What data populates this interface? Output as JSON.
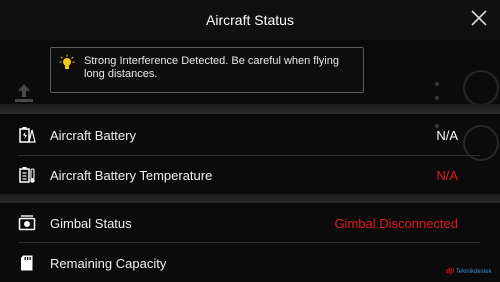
{
  "header": {
    "title": "Aircraft Status"
  },
  "alert": {
    "text": "Strong Interference Detected. Be careful when flying long distances."
  },
  "rows": [
    {
      "label": "Aircraft Battery",
      "value": "N/A",
      "value_color": "#ffffff",
      "icon": "battery-icon"
    },
    {
      "label": "Aircraft Battery Temperature",
      "value": "N/A",
      "value_color": "#e21b1b",
      "icon": "battery-temperature-icon"
    },
    {
      "label": "Gimbal Status",
      "value": "Gimbal Disconnected",
      "value_color": "#e21b1b",
      "icon": "gimbal-icon"
    },
    {
      "label": "Remaining Capacity",
      "value": "",
      "value_color": "#ffffff",
      "icon": "sd-card-icon"
    }
  ],
  "watermark": {
    "brand": "dji",
    "text": "Tekniikdestek"
  },
  "colors": {
    "accent_warning": "#f5c518",
    "error": "#e21b1b"
  }
}
